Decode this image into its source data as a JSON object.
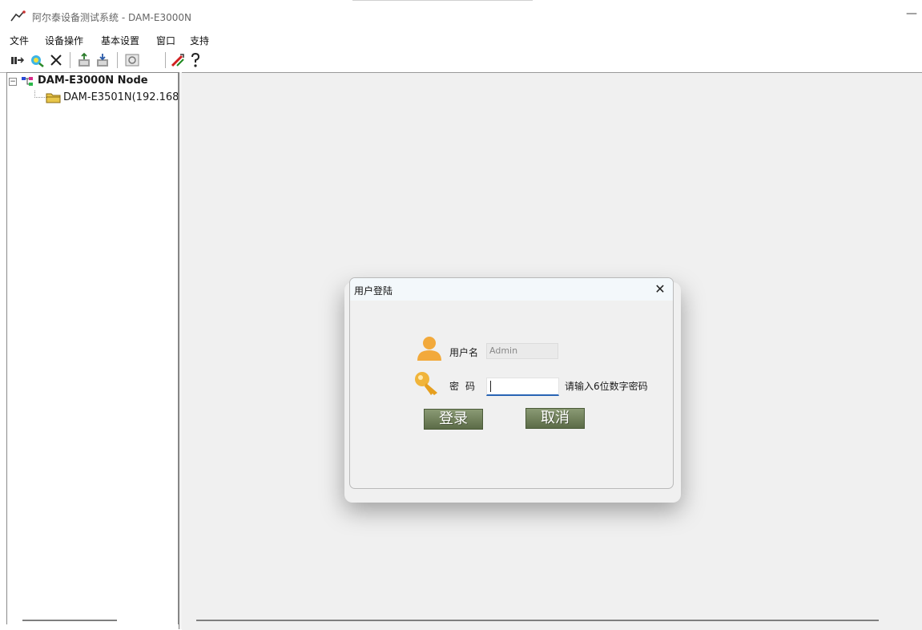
{
  "window": {
    "title": "阿尔泰设备测试系统 - DAM-E3000N",
    "minimize_glyph": "—"
  },
  "menu": {
    "items": [
      "文件",
      "设备操作",
      "基本设置",
      "窗口",
      "支持"
    ]
  },
  "toolbar": {
    "buttons": [
      "connect-icon",
      "search-device-icon",
      "disconnect-icon",
      "upload-icon",
      "download-icon",
      "refresh-icon",
      "paint-icon",
      "help-icon"
    ]
  },
  "tree": {
    "root_label": "DAM-E3000N Node",
    "expander": "⊟",
    "child_label": "DAM-E3501N(192.168"
  },
  "dialog": {
    "title": "用户登陆",
    "close_glyph": "✕",
    "username_label": "用户名",
    "username_value": "Admin",
    "password_label": "密码",
    "password_hint": "请输入6位数字密码",
    "login_button": "登录",
    "cancel_button": "取消"
  },
  "colors": {
    "button_green": "#6b7b57",
    "focus_blue": "#2864b4",
    "user_icon": "#f2a93b",
    "key_icon": "#f0b43a"
  }
}
